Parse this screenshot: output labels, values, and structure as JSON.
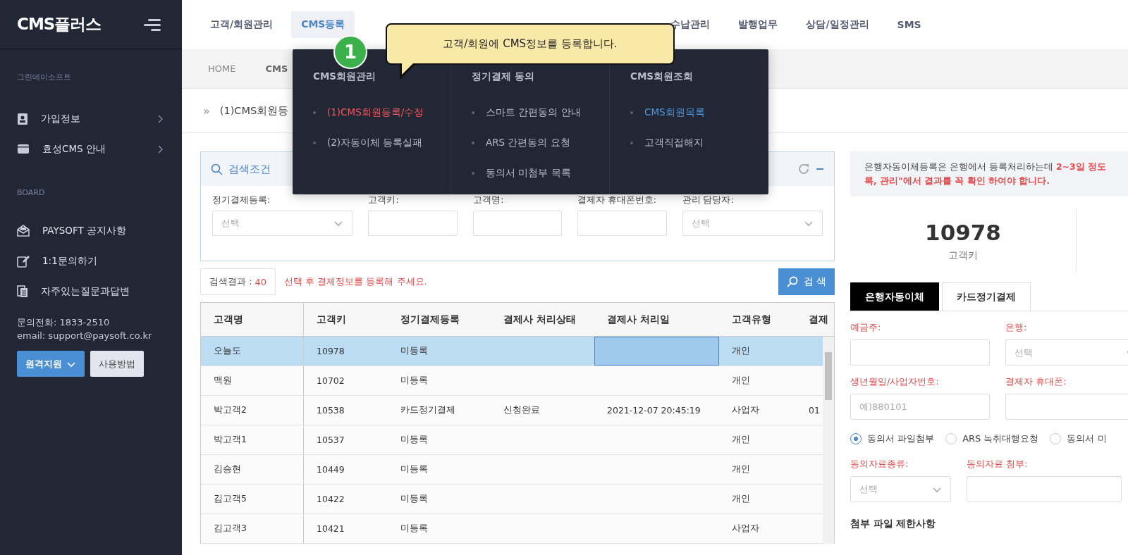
{
  "sidebar": {
    "logo": "CMS플러스",
    "company": "그린데이소프트",
    "menu": [
      {
        "label": "가입정보"
      },
      {
        "label": "효성CMS 안내"
      }
    ],
    "board_title": "BOARD",
    "board": [
      {
        "label": "PAYSOFT 공지사항"
      },
      {
        "label": "1:1문의하기"
      },
      {
        "label": "자주있는질문과답변"
      }
    ],
    "phone": "문의전화: 1833-2510",
    "email": "email: support@paysoft.co.kr",
    "buttons": [
      {
        "label": "원격지원",
        "kind": "primary"
      },
      {
        "label": "사용방법",
        "kind": "secondary"
      }
    ]
  },
  "top_nav": [
    {
      "label": "고객/회원관리",
      "selected": false
    },
    {
      "label": "CMS등록",
      "selected": true
    },
    {
      "label": "수납관리",
      "selected": false
    },
    {
      "label": "발행업무",
      "selected": false
    },
    {
      "label": "상담/일정관리",
      "selected": false
    },
    {
      "label": "SMS",
      "selected": false
    }
  ],
  "breadcrumb": [
    "HOME",
    "CMS"
  ],
  "page_title_mark": "»",
  "page_title": "(1)CMS회원등",
  "dropdown": {
    "columns": [
      {
        "title": "CMS회원관리",
        "items": [
          {
            "label": "(1)CMS회원등록/수정",
            "kind": "current"
          },
          {
            "label": "(2)자동이체 등록실패",
            "kind": "normal"
          }
        ]
      },
      {
        "title": "정기결제 동의",
        "items": [
          {
            "label": "스마트 간편동의 안내",
            "kind": "normal"
          },
          {
            "label": "ARS 간편동의 요청",
            "kind": "normal"
          },
          {
            "label": "동의서 미첨부 목록",
            "kind": "normal"
          }
        ]
      },
      {
        "title": "CMS회원조회",
        "items": [
          {
            "label": "CMS회원목록",
            "kind": "link"
          },
          {
            "label": "고객직접해지",
            "kind": "normal"
          }
        ]
      }
    ]
  },
  "tooltip": {
    "step": "1",
    "text": "고객/회원에 CMS정보를 등록합니다."
  },
  "search": {
    "title": "검색조건",
    "fields": [
      {
        "label": "정기결제등록:",
        "kind": "select",
        "placeholder": "선택"
      },
      {
        "label": "고객키:",
        "kind": "input"
      },
      {
        "label": "고객명:",
        "kind": "input"
      },
      {
        "label": "결제자 휴대폰번호:",
        "kind": "input"
      },
      {
        "label": "관리 담당자:",
        "kind": "select",
        "placeholder": "선택"
      }
    ]
  },
  "result": {
    "label": "검색결과 :",
    "count": "40",
    "message": "선택 후 결제정보를 등록해 주세요.",
    "button": "검 색"
  },
  "table": {
    "columns": [
      "고객명",
      "고객키",
      "정기결제등록",
      "결제사 처리상태",
      "결제사 처리일",
      "고객유형",
      "결제"
    ],
    "rows": [
      {
        "selected": true,
        "cells": {
          "0": "오늘도",
          "1": "10978",
          "2": "미등록",
          "5": "개인"
        }
      },
      {
        "selected": false,
        "cells": {
          "0": "맥원",
          "1": "10702",
          "2": "미등록",
          "5": "개인"
        }
      },
      {
        "selected": false,
        "cells": {
          "0": "박고객2",
          "1": "10538",
          "2": "카드정기결제",
          "3": "신청완료",
          "4": "2021-12-07 20:45:19",
          "5": "사업자",
          "6": "01"
        }
      },
      {
        "selected": false,
        "cells": {
          "0": "박고객1",
          "1": "10537",
          "2": "미등록",
          "5": "개인"
        }
      },
      {
        "selected": false,
        "cells": {
          "0": "김승현",
          "1": "10449",
          "2": "미등록",
          "5": "개인"
        }
      },
      {
        "selected": false,
        "cells": {
          "0": "김고객5",
          "1": "10422",
          "2": "미등록",
          "5": "개인"
        }
      },
      {
        "selected": false,
        "cells": {
          "0": "김고객3",
          "1": "10421",
          "2": "미등록",
          "5": "사업자"
        }
      }
    ]
  },
  "notice": {
    "line_1": "은행자동이체등록은 은행에서 등록처리하는데 **2~3일 정도**",
    "line_2": "록, 관리\"에서 결과를 꼭 확인 하여야 합니다."
  },
  "stat": {
    "value": "10978",
    "label": "고객키"
  },
  "tabs": [
    {
      "label": "은행자동이체",
      "selected": true
    },
    {
      "label": "카드정기결제",
      "selected": false
    }
  ],
  "form": {
    "rows": [
      [
        {
          "label": "예금주:",
          "kind": "input"
        },
        {
          "label": "은행:",
          "kind": "select",
          "placeholder": "선택"
        }
      ],
      [
        {
          "label": "생년월일/사업자번호:",
          "kind": "input",
          "placeholder": "예)880101"
        },
        {
          "label": "결제자 휴대폰:",
          "kind": "input"
        }
      ]
    ],
    "radios": [
      {
        "label": "동의서 파일첨부",
        "selected": true
      },
      {
        "label": "ARS 녹취대행요청",
        "selected": false
      },
      {
        "label": "동의서 미",
        "selected": false
      }
    ],
    "attach": [
      {
        "label": "동의자료종류:",
        "kind": "select",
        "placeholder": "선택"
      },
      {
        "label": "동의자료 첨부:",
        "kind": "input"
      }
    ],
    "limits_title": "첨부 파일 제한사항"
  }
}
